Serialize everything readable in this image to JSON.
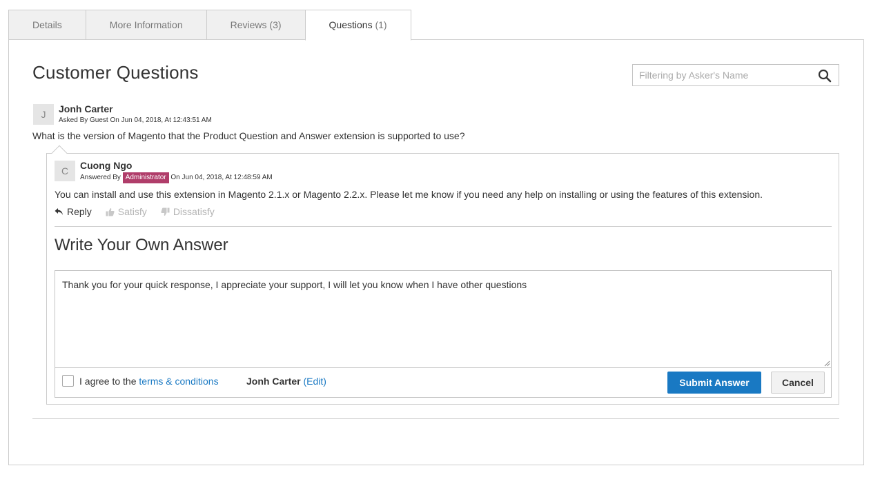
{
  "tabs": [
    {
      "label": "Details",
      "count": ""
    },
    {
      "label": "More Information",
      "count": ""
    },
    {
      "label": "Reviews",
      "count": "(3)"
    },
    {
      "label": "Questions",
      "count": "(1)"
    }
  ],
  "section_title": "Customer Questions",
  "search": {
    "placeholder": "Filtering by Asker's Name"
  },
  "question": {
    "avatar_letter": "J",
    "author": "Jonh Carter",
    "meta": "Asked By Guest On Jun 04, 2018, At 12:43:51 AM",
    "text": "What is the version of Magento that the Product Question and Answer extension is supported to use?"
  },
  "answer": {
    "avatar_letter": "C",
    "author": "Cuong Ngo",
    "meta_prefix": "Answered By",
    "role_badge": "Administrator",
    "meta_suffix": "On Jun 04, 2018, At 12:48:59 AM",
    "text": "You can install and use this extension in Magento 2.1.x or Magento 2.2.x. Please let me know if you need any help on installing or using the features of this extension.",
    "actions": {
      "reply": "Reply",
      "satisfy": "Satisfy",
      "dissatisfy": "Dissatisfy"
    }
  },
  "write_answer": {
    "title": "Write Your Own Answer",
    "textarea_value": "Thank you for your quick response, I appreciate your support, I will let you know when I have other questions",
    "agree_prefix": "I agree to the",
    "terms_link": "terms & conditions",
    "author_name": "Jonh Carter",
    "edit_open": "(",
    "edit_label": "Edit",
    "edit_close": ")",
    "submit_label": "Submit Answer",
    "cancel_label": "Cancel"
  },
  "colors": {
    "accent": "#1979c3",
    "badge": "#b03d6a"
  }
}
